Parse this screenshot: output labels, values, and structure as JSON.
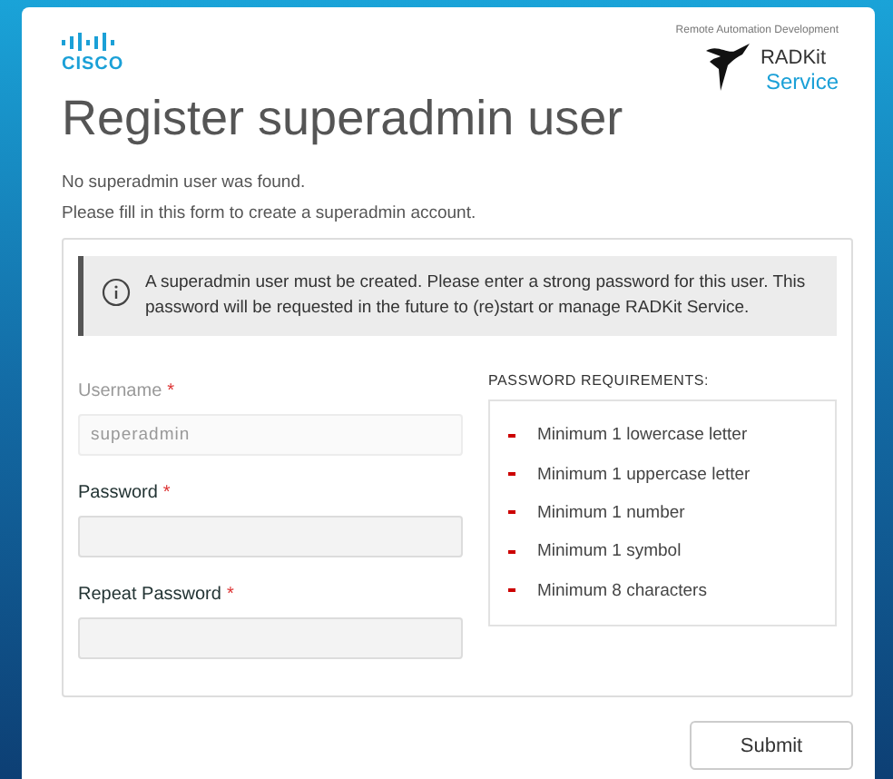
{
  "header": {
    "brand": "CISCO",
    "product_tagline": "Remote Automation Development",
    "product_name": "RADKit",
    "product_sub": "Service"
  },
  "title": "Register superadmin user",
  "intro": [
    "No superadmin user was found.",
    "Please fill in this form to create a superadmin account."
  ],
  "notice": "A superadmin user must be created. Please enter a strong password for this user. This password will be requested in the future to (re)start or manage RADKit Service.",
  "fields": [
    {
      "label": "Username",
      "required_mark": "*",
      "value": "superadmin",
      "disabled": true
    },
    {
      "label": "Password",
      "required_mark": "*",
      "disabled": false
    },
    {
      "label": "Repeat Password",
      "required_mark": "*",
      "disabled": false
    }
  ],
  "requirements": {
    "title": "PASSWORD REQUIREMENTS:",
    "items": [
      "Minimum 1 lowercase letter",
      "Minimum 1 uppercase letter",
      "Minimum 1 number",
      "Minimum 1 symbol",
      "Minimum 8 characters"
    ]
  },
  "buttons": [
    "Submit"
  ]
}
